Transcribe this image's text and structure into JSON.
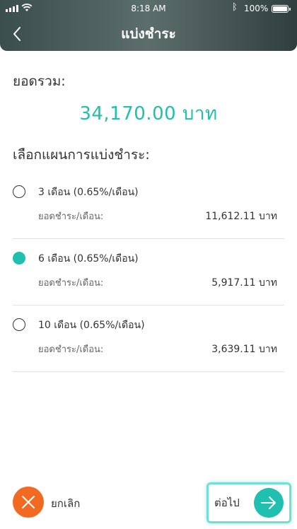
{
  "status_bar": {
    "time": "8:18 AM",
    "battery": "100%",
    "bluetooth_icon": "bluetooth-icon",
    "wifi_icon": "wifi-icon",
    "signal_icon": "signal-icon"
  },
  "header": {
    "title": "แบ่งชำระ",
    "back_icon": "chevron-left-icon"
  },
  "total": {
    "label": "ยอดรวม:",
    "amount": "34,170.00 บาท"
  },
  "plans": {
    "title": "เลือกแผนการแบ่งชำระ:",
    "items": [
      {
        "name": "3 เดือน (0.65%/เดือน)",
        "per_month_label": "ยอดชำระ/เดือน:",
        "per_month_value": "11,612.11 บาท",
        "selected": false
      },
      {
        "name": "6 เดือน (0.65%/เดือน)",
        "per_month_label": "ยอดชำระ/เดือน:",
        "per_month_value": "5,917.11 บาท",
        "selected": true
      },
      {
        "name": "10 เดือน (0.65%/เดือน)",
        "per_month_label": "ยอดชำระ/เดือน:",
        "per_month_value": "3,639.11 บาท",
        "selected": false
      }
    ]
  },
  "footer": {
    "cancel_label": "ยกเลิก",
    "next_label": "ต่อไป",
    "cancel_icon": "close-icon",
    "next_icon": "arrow-right-icon"
  },
  "colors": {
    "accent": "#1fc0b0",
    "cancel": "#f26a22",
    "header_bg": "#4a5c5a"
  }
}
